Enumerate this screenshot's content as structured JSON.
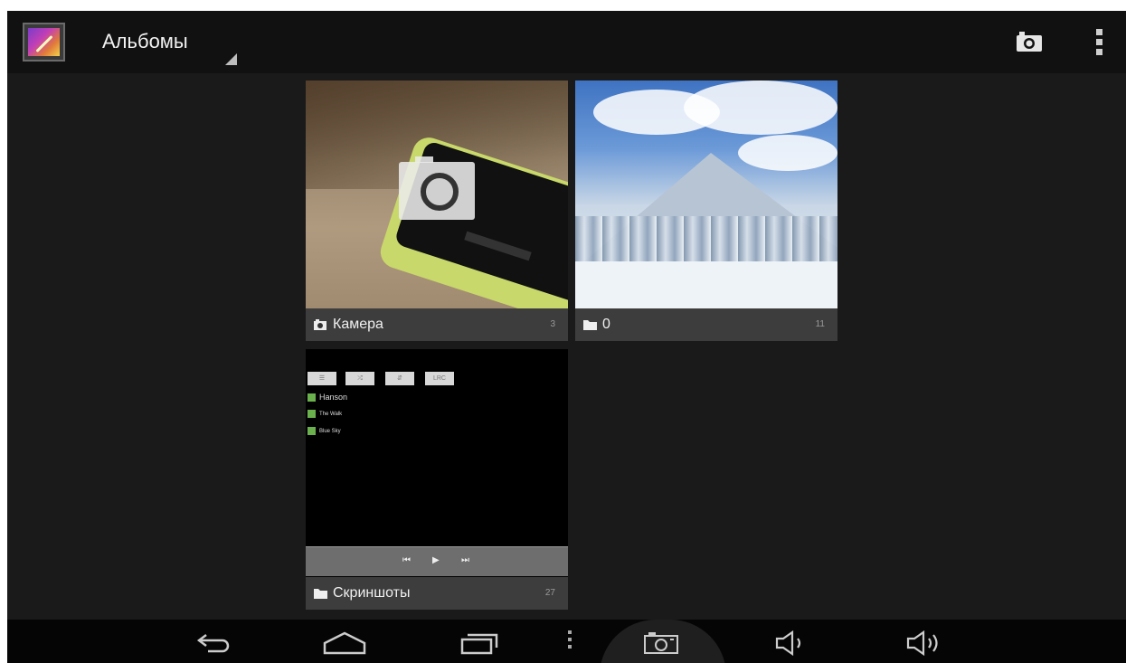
{
  "action_bar": {
    "title": "Альбомы"
  },
  "albums": [
    {
      "name": "Камера",
      "count": "3",
      "icon": "camera-icon"
    },
    {
      "name": "0",
      "count": "11",
      "icon": "folder-icon"
    },
    {
      "name": "Скриншоты",
      "count": "27",
      "icon": "folder-icon"
    }
  ],
  "screenshot_thumb": {
    "buttons": [
      "☰",
      "⤮",
      "⇵",
      "LRC"
    ],
    "tracks": [
      "Hanson",
      "The Walk",
      "Blue Sky"
    ]
  },
  "nav_bar": {
    "icons": [
      "back-icon",
      "home-icon",
      "recent-apps-icon",
      "menu-icon",
      "screenshot-camera-icon",
      "volume-down-icon",
      "volume-up-icon"
    ]
  },
  "colors": {
    "background": "#1a1a1a",
    "action_bar": "#111111",
    "label_bar": "#3d3d3d",
    "nav_bar": "#050505"
  }
}
